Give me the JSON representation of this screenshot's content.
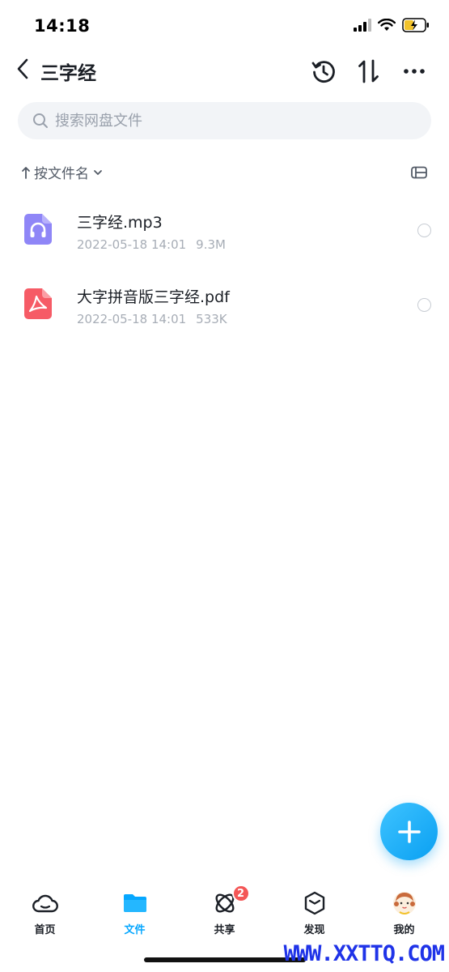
{
  "status_bar": {
    "time": "14:18"
  },
  "header": {
    "title": "三字经"
  },
  "search": {
    "placeholder": "搜索网盘文件",
    "value": ""
  },
  "sort": {
    "label": "按文件名"
  },
  "files": [
    {
      "name": "三字经.mp3",
      "date": "2022-05-18 14:01",
      "size": "9.3M",
      "type": "audio",
      "icon_color": "#8f86f7"
    },
    {
      "name": "大字拼音版三字经.pdf",
      "date": "2022-05-18 14:01",
      "size": "533K",
      "type": "pdf",
      "icon_color": "#f65b66"
    }
  ],
  "tabs": [
    {
      "label": "首页",
      "icon": "cloud-icon"
    },
    {
      "label": "文件",
      "icon": "folder-icon",
      "active": true
    },
    {
      "label": "共享",
      "icon": "share-icon",
      "badge": "2"
    },
    {
      "label": "发现",
      "icon": "cube-icon"
    },
    {
      "label": "我的",
      "icon": "avatar"
    }
  ],
  "watermark": "WWW.XXTTQ.COM",
  "colors": {
    "accent": "#06a7ff",
    "badge": "#f45656"
  }
}
